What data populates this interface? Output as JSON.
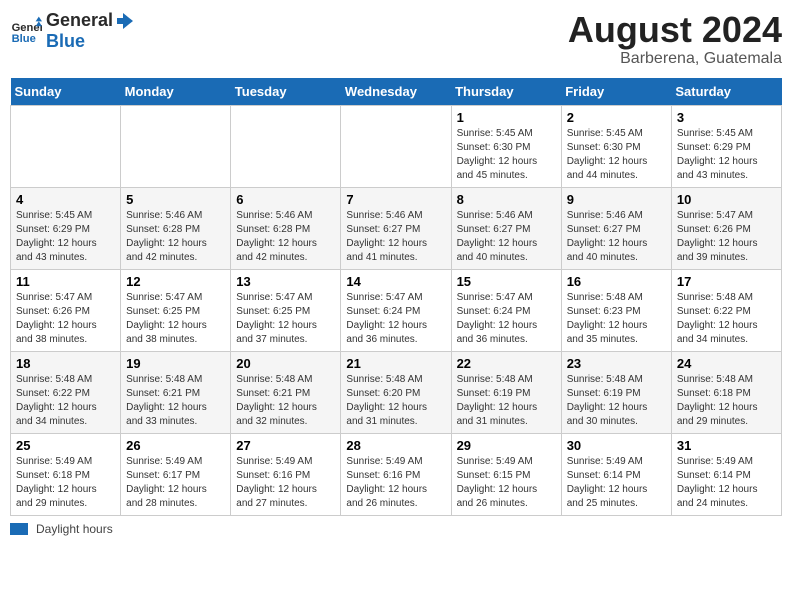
{
  "header": {
    "logo_line1": "General",
    "logo_line2": "Blue",
    "title": "August 2024",
    "subtitle": "Barberena, Guatemala"
  },
  "days_of_week": [
    "Sunday",
    "Monday",
    "Tuesday",
    "Wednesday",
    "Thursday",
    "Friday",
    "Saturday"
  ],
  "weeks": [
    [
      {
        "num": "",
        "info": ""
      },
      {
        "num": "",
        "info": ""
      },
      {
        "num": "",
        "info": ""
      },
      {
        "num": "",
        "info": ""
      },
      {
        "num": "1",
        "info": "Sunrise: 5:45 AM\nSunset: 6:30 PM\nDaylight: 12 hours\nand 45 minutes."
      },
      {
        "num": "2",
        "info": "Sunrise: 5:45 AM\nSunset: 6:30 PM\nDaylight: 12 hours\nand 44 minutes."
      },
      {
        "num": "3",
        "info": "Sunrise: 5:45 AM\nSunset: 6:29 PM\nDaylight: 12 hours\nand 43 minutes."
      }
    ],
    [
      {
        "num": "4",
        "info": "Sunrise: 5:45 AM\nSunset: 6:29 PM\nDaylight: 12 hours\nand 43 minutes."
      },
      {
        "num": "5",
        "info": "Sunrise: 5:46 AM\nSunset: 6:28 PM\nDaylight: 12 hours\nand 42 minutes."
      },
      {
        "num": "6",
        "info": "Sunrise: 5:46 AM\nSunset: 6:28 PM\nDaylight: 12 hours\nand 42 minutes."
      },
      {
        "num": "7",
        "info": "Sunrise: 5:46 AM\nSunset: 6:27 PM\nDaylight: 12 hours\nand 41 minutes."
      },
      {
        "num": "8",
        "info": "Sunrise: 5:46 AM\nSunset: 6:27 PM\nDaylight: 12 hours\nand 40 minutes."
      },
      {
        "num": "9",
        "info": "Sunrise: 5:46 AM\nSunset: 6:27 PM\nDaylight: 12 hours\nand 40 minutes."
      },
      {
        "num": "10",
        "info": "Sunrise: 5:47 AM\nSunset: 6:26 PM\nDaylight: 12 hours\nand 39 minutes."
      }
    ],
    [
      {
        "num": "11",
        "info": "Sunrise: 5:47 AM\nSunset: 6:26 PM\nDaylight: 12 hours\nand 38 minutes."
      },
      {
        "num": "12",
        "info": "Sunrise: 5:47 AM\nSunset: 6:25 PM\nDaylight: 12 hours\nand 38 minutes."
      },
      {
        "num": "13",
        "info": "Sunrise: 5:47 AM\nSunset: 6:25 PM\nDaylight: 12 hours\nand 37 minutes."
      },
      {
        "num": "14",
        "info": "Sunrise: 5:47 AM\nSunset: 6:24 PM\nDaylight: 12 hours\nand 36 minutes."
      },
      {
        "num": "15",
        "info": "Sunrise: 5:47 AM\nSunset: 6:24 PM\nDaylight: 12 hours\nand 36 minutes."
      },
      {
        "num": "16",
        "info": "Sunrise: 5:48 AM\nSunset: 6:23 PM\nDaylight: 12 hours\nand 35 minutes."
      },
      {
        "num": "17",
        "info": "Sunrise: 5:48 AM\nSunset: 6:22 PM\nDaylight: 12 hours\nand 34 minutes."
      }
    ],
    [
      {
        "num": "18",
        "info": "Sunrise: 5:48 AM\nSunset: 6:22 PM\nDaylight: 12 hours\nand 34 minutes."
      },
      {
        "num": "19",
        "info": "Sunrise: 5:48 AM\nSunset: 6:21 PM\nDaylight: 12 hours\nand 33 minutes."
      },
      {
        "num": "20",
        "info": "Sunrise: 5:48 AM\nSunset: 6:21 PM\nDaylight: 12 hours\nand 32 minutes."
      },
      {
        "num": "21",
        "info": "Sunrise: 5:48 AM\nSunset: 6:20 PM\nDaylight: 12 hours\nand 31 minutes."
      },
      {
        "num": "22",
        "info": "Sunrise: 5:48 AM\nSunset: 6:19 PM\nDaylight: 12 hours\nand 31 minutes."
      },
      {
        "num": "23",
        "info": "Sunrise: 5:48 AM\nSunset: 6:19 PM\nDaylight: 12 hours\nand 30 minutes."
      },
      {
        "num": "24",
        "info": "Sunrise: 5:48 AM\nSunset: 6:18 PM\nDaylight: 12 hours\nand 29 minutes."
      }
    ],
    [
      {
        "num": "25",
        "info": "Sunrise: 5:49 AM\nSunset: 6:18 PM\nDaylight: 12 hours\nand 29 minutes."
      },
      {
        "num": "26",
        "info": "Sunrise: 5:49 AM\nSunset: 6:17 PM\nDaylight: 12 hours\nand 28 minutes."
      },
      {
        "num": "27",
        "info": "Sunrise: 5:49 AM\nSunset: 6:16 PM\nDaylight: 12 hours\nand 27 minutes."
      },
      {
        "num": "28",
        "info": "Sunrise: 5:49 AM\nSunset: 6:16 PM\nDaylight: 12 hours\nand 26 minutes."
      },
      {
        "num": "29",
        "info": "Sunrise: 5:49 AM\nSunset: 6:15 PM\nDaylight: 12 hours\nand 26 minutes."
      },
      {
        "num": "30",
        "info": "Sunrise: 5:49 AM\nSunset: 6:14 PM\nDaylight: 12 hours\nand 25 minutes."
      },
      {
        "num": "31",
        "info": "Sunrise: 5:49 AM\nSunset: 6:14 PM\nDaylight: 12 hours\nand 24 minutes."
      }
    ]
  ],
  "footer": {
    "daylight_label": "Daylight hours"
  }
}
